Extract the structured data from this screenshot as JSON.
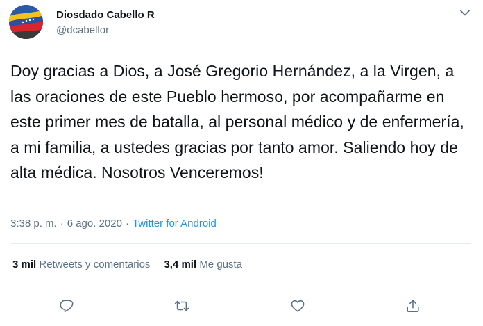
{
  "author": {
    "name": "Diosdado Cabello R",
    "handle": "@dcabellor"
  },
  "tweet": {
    "text": "Doy gracias a Dios, a José Gregorio Hernández, a la Virgen, a las oraciones de este Pueblo hermoso, por acompañarme en este primer mes de batalla, al personal médico y de enfermería, a mi familia, a ustedes gracias por tanto amor. Saliendo hoy de alta médica. Nosotros Venceremos!",
    "time": "3:38 p. m.",
    "separator": "·",
    "date": "6 ago. 2020",
    "source": "Twitter for Android"
  },
  "stats": {
    "retweets_count": "3 mil",
    "retweets_label": "Retweets y comentarios",
    "likes_count": "3,4 mil",
    "likes_label": "Me gusta"
  },
  "icons": {
    "more": "chevron-down-icon",
    "reply": "reply-icon",
    "retweet": "retweet-icon",
    "like": "heart-icon",
    "share": "share-icon"
  },
  "colors": {
    "text": "#0f1419",
    "secondary": "#5b7083",
    "link": "#1b95e0",
    "divider": "#e6ecf0"
  }
}
